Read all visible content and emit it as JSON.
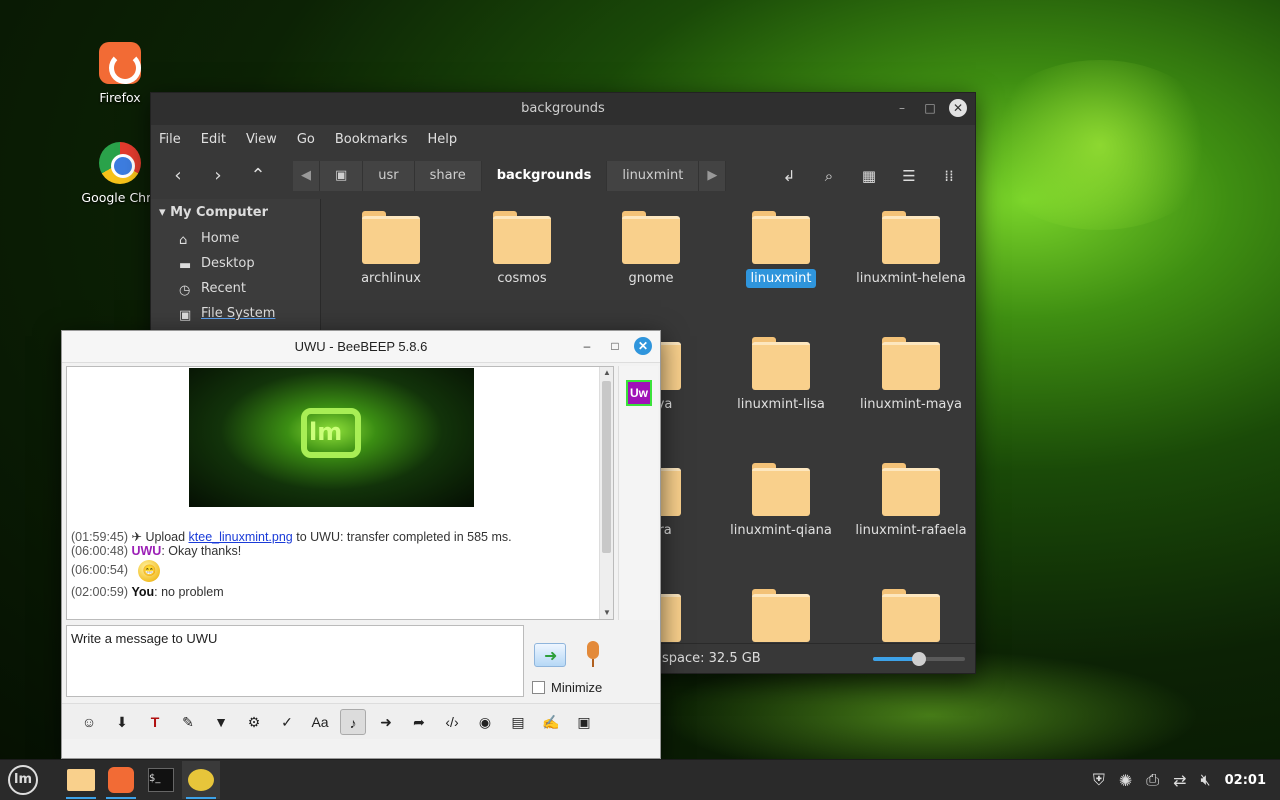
{
  "desktop": {
    "icons": [
      {
        "label": "Firefox"
      },
      {
        "label": "Google Chro"
      }
    ]
  },
  "file_manager": {
    "title": "backgrounds",
    "menu": [
      "File",
      "Edit",
      "View",
      "Go",
      "Bookmarks",
      "Help"
    ],
    "breadcrumbs": [
      "usr",
      "share",
      "backgrounds",
      "linuxmint"
    ],
    "active_crumb": "backgrounds",
    "sidebar": {
      "heading": "My Computer",
      "items": [
        "Home",
        "Desktop",
        "Recent",
        "File System"
      ]
    },
    "folders": [
      "archlinux",
      "cosmos",
      "gnome",
      "linuxmint",
      "linuxmint-helena",
      "-katya",
      "linuxmint-lisa",
      "linuxmint-maya",
      "-petra",
      "linuxmint-qiana",
      "linuxmint-rafaela"
    ],
    "selected_folder": "linuxmint",
    "status_free_space": "space: 32.5 GB",
    "zoom_level_fraction": 0.5
  },
  "chat": {
    "title": "UWU - BeeBEEP 5.8.6",
    "image_logo_text": "lm",
    "messages": [
      {
        "ts": "(01:59:45)",
        "prefix": "Upload ",
        "link": "ktee_linuxmint.png",
        "suffix": " to UWU: transfer completed in 585 ms."
      },
      {
        "ts": "(06:00:48)",
        "who": "UWU",
        "text": ": Okay thanks!"
      },
      {
        "ts": "(06:00:54)",
        "emoji": "😁"
      },
      {
        "ts": "(02:00:59)",
        "who": "You",
        "text": ": no problem"
      }
    ],
    "user_badge": "Uw",
    "input_placeholder": "Write a message to UWU",
    "minimize_label": "Minimize",
    "minimize_checked": false
  },
  "taskbar": {
    "clock": "02:01"
  }
}
